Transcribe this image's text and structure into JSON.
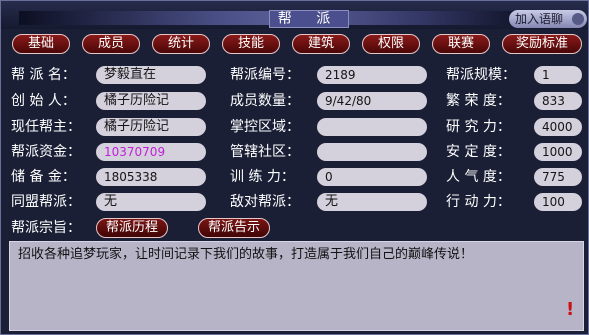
{
  "window": {
    "title": "帮 派",
    "join_chat": "加入语聊"
  },
  "tabs": [
    {
      "label": "基础"
    },
    {
      "label": "成员"
    },
    {
      "label": "统计"
    },
    {
      "label": "技能"
    },
    {
      "label": "建筑"
    },
    {
      "label": "权限"
    },
    {
      "label": "联赛"
    },
    {
      "label": "奖励标准"
    }
  ],
  "info": {
    "col1": [
      {
        "label": "帮 派 名：",
        "value": "梦毅直在"
      },
      {
        "label": "创 始 人：",
        "value": "橘子历险记"
      },
      {
        "label": "现任帮主：",
        "value": "橘子历险记"
      },
      {
        "label": "帮派资金：",
        "value": "10370709"
      },
      {
        "label": "储 备 金：",
        "value": "1805338"
      },
      {
        "label": "同盟帮派：",
        "value": "无"
      }
    ],
    "col2": [
      {
        "label": "帮派编号：",
        "value": "2189"
      },
      {
        "label": "成员数量：",
        "value": "9/42/80"
      },
      {
        "label": "掌控区域：",
        "value": ""
      },
      {
        "label": "管辖社区：",
        "value": ""
      },
      {
        "label": "训 练 力：",
        "value": "0"
      },
      {
        "label": "敌对帮派：",
        "value": "无"
      }
    ],
    "col3": [
      {
        "label": "帮派规模：",
        "value": "1"
      },
      {
        "label": "繁 荣 度：",
        "value": "833"
      },
      {
        "label": "研 究 力：",
        "value": "4000"
      },
      {
        "label": "安 定 度：",
        "value": "1000"
      },
      {
        "label": "人 气 度：",
        "value": "775"
      },
      {
        "label": "行 动 力：",
        "value": "100"
      }
    ]
  },
  "slogan": {
    "label": "帮派宗旨：",
    "history_button": "帮派历程",
    "notice_button": "帮派告示",
    "text": "招收各种追梦玩家，让时间记录下我们的故事，打造属于我们自己的巅峰传说！",
    "flag": "!"
  },
  "colors": {
    "money": "#c020d8",
    "tab_bg": "#6a1010",
    "field_bg": "#d4d0dc"
  }
}
